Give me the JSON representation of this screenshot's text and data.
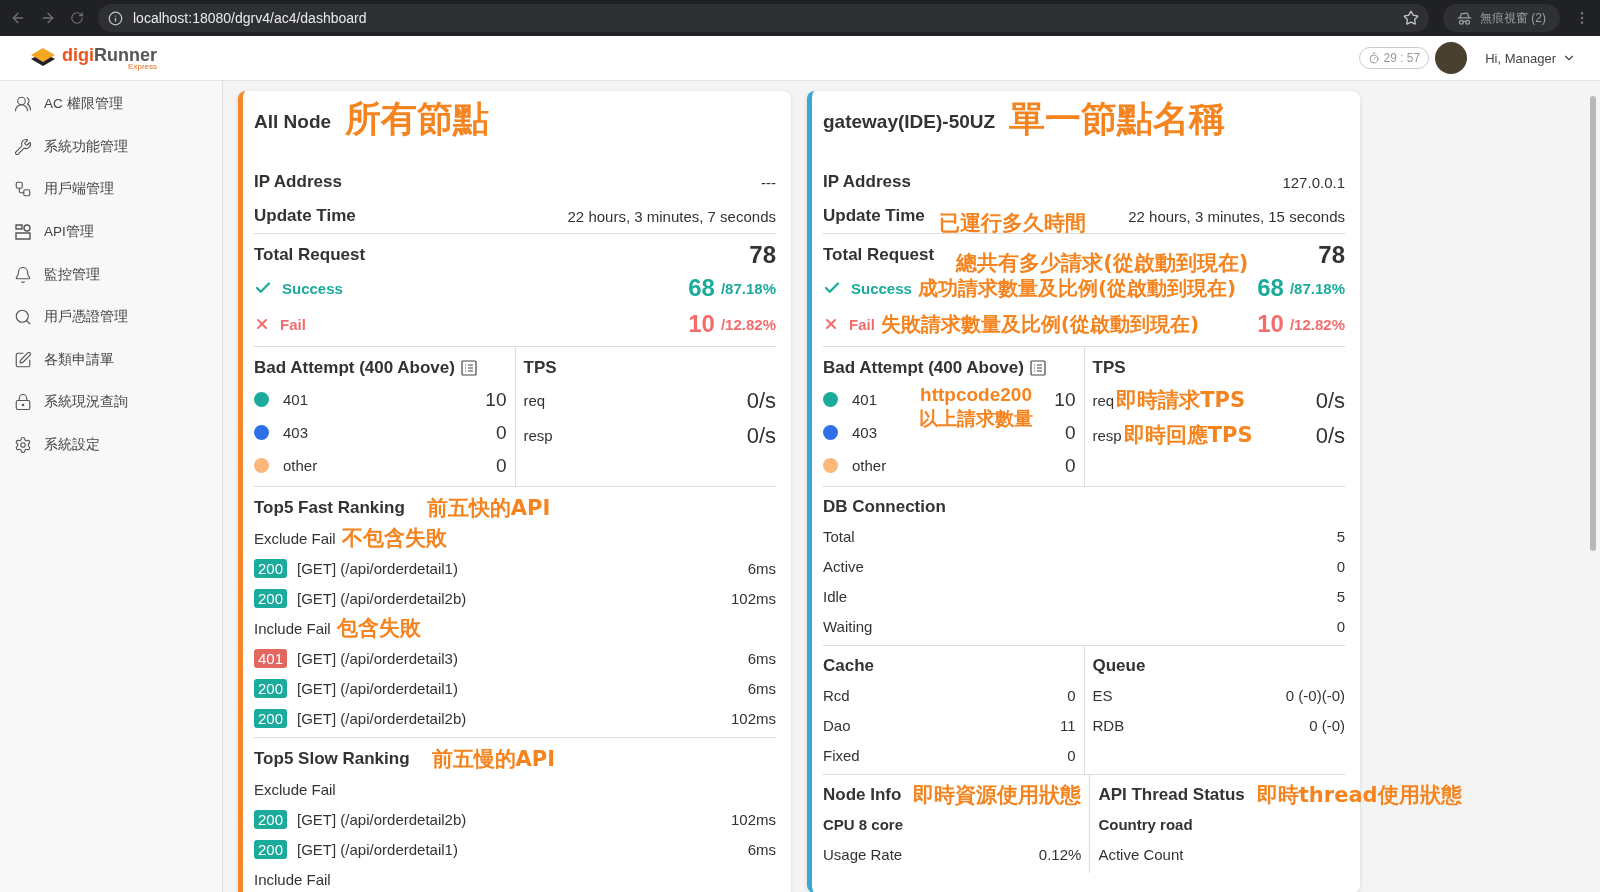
{
  "browser": {
    "url": "localhost:18080/dgrv4/ac4/dashboard",
    "profile": "無痕視窗 (2)"
  },
  "header": {
    "brand": "digiRunner",
    "brand_sub": "Express",
    "timer": "29 : 57",
    "greeting": "Hi, Manager"
  },
  "sidebar": {
    "items": [
      {
        "label": "AC 權限管理"
      },
      {
        "label": "系統功能管理"
      },
      {
        "label": "用戶端管理"
      },
      {
        "label": "API管理"
      },
      {
        "label": "監控管理"
      },
      {
        "label": "用戶憑證管理"
      },
      {
        "label": "各類申請單"
      },
      {
        "label": "系統現況查詢"
      },
      {
        "label": "系統設定"
      }
    ]
  },
  "cards": [
    {
      "color": "#f5882a",
      "title": "All Node",
      "note": "所有節點",
      "info": [
        {
          "label": "IP Address",
          "value": "---"
        },
        {
          "label": "Update Time",
          "value": "22 hours, 3 minutes, 7 seconds"
        }
      ],
      "total": {
        "label": "Total Request",
        "value": "78"
      },
      "outcomes": [
        {
          "kind": "success",
          "label": "Success",
          "count": "68",
          "ratio": "/87.18%"
        },
        {
          "kind": "fail",
          "label": "Fail",
          "count": "10",
          "ratio": "/12.82%"
        }
      ],
      "bad": {
        "title": "Bad Attempt (400 Above)",
        "rows": [
          {
            "label": "401",
            "value": "10",
            "color": "#1aab9b"
          },
          {
            "label": "403",
            "value": "0",
            "color": "#2f6fe8"
          },
          {
            "label": "other",
            "value": "0",
            "color": "#fbb87a"
          }
        ]
      },
      "tps": {
        "title": "TPS",
        "rows": [
          {
            "label": "req",
            "value": "0/s"
          },
          {
            "label": "resp",
            "value": "0/s"
          }
        ]
      },
      "sections": [
        {
          "kind": "ranking",
          "title": "Top5 Fast Ranking",
          "note": "前五快的API",
          "groups": [
            {
              "label": "Exclude Fail",
              "note": "不包含失敗",
              "rows": [
                {
                  "code": "200",
                  "color": "#1aab9b",
                  "path": "[GET] (/api/orderdetail1)",
                  "time": "6ms"
                },
                {
                  "code": "200",
                  "color": "#1aab9b",
                  "path": "[GET] (/api/orderdetail2b)",
                  "time": "102ms"
                }
              ]
            },
            {
              "label": "Include Fail",
              "note": "包含失敗",
              "rows": [
                {
                  "code": "401",
                  "color": "#e4675f",
                  "path": "[GET] (/api/orderdetail3)",
                  "time": "6ms"
                },
                {
                  "code": "200",
                  "color": "#1aab9b",
                  "path": "[GET] (/api/orderdetail1)",
                  "time": "6ms"
                },
                {
                  "code": "200",
                  "color": "#1aab9b",
                  "path": "[GET] (/api/orderdetail2b)",
                  "time": "102ms"
                }
              ]
            }
          ]
        },
        {
          "kind": "ranking",
          "title": "Top5 Slow Ranking",
          "note": "前五慢的API",
          "groups": [
            {
              "label": "Exclude Fail",
              "rows": [
                {
                  "code": "200",
                  "color": "#1aab9b",
                  "path": "[GET] (/api/orderdetail2b)",
                  "time": "102ms"
                },
                {
                  "code": "200",
                  "color": "#1aab9b",
                  "path": "[GET] (/api/orderdetail1)",
                  "time": "6ms"
                }
              ]
            },
            {
              "label": "Include Fail"
            }
          ]
        }
      ]
    },
    {
      "color": "#3aa6d4",
      "title": "gateway(IDE)-50UZ",
      "note": "單一節點名稱",
      "info": [
        {
          "label": "IP Address",
          "value": "127.0.0.1"
        },
        {
          "label": "Update Time",
          "value": "22 hours, 3 minutes, 15 seconds",
          "note": "已運行多久時間"
        }
      ],
      "total": {
        "label": "Total Request",
        "value": "78",
        "note": "總共有多少請求(從啟動到現在)"
      },
      "outcomes": [
        {
          "kind": "success",
          "label": "Success",
          "count": "68",
          "ratio": "/87.18%",
          "note": "成功請求數量及比例(從啟動到現在)"
        },
        {
          "kind": "fail",
          "label": "Fail",
          "count": "10",
          "ratio": "/12.82%",
          "note": "失敗請求數量及比例(從啟動到現在)"
        }
      ],
      "bad": {
        "title": "Bad Attempt (400 Above)",
        "note": [
          "httpcode200",
          "以上請求數量"
        ],
        "rows": [
          {
            "label": "401",
            "value": "10",
            "color": "#1aab9b"
          },
          {
            "label": "403",
            "value": "0",
            "color": "#2f6fe8"
          },
          {
            "label": "other",
            "value": "0",
            "color": "#fbb87a"
          }
        ]
      },
      "tps": {
        "title": "TPS",
        "rows": [
          {
            "label": "req",
            "value": "0/s",
            "note": "即時請求TPS"
          },
          {
            "label": "resp",
            "value": "0/s",
            "note": "即時回應TPS"
          }
        ]
      },
      "sections": [
        {
          "kind": "list",
          "title": "DB Connection",
          "rows": [
            {
              "label": "Total",
              "value": "5"
            },
            {
              "label": "Active",
              "value": "0"
            },
            {
              "label": "Idle",
              "value": "5"
            },
            {
              "label": "Waiting",
              "value": "0"
            }
          ]
        },
        {
          "kind": "split",
          "columns": [
            {
              "title": "Cache",
              "rows": [
                {
                  "label": "Rcd",
                  "value": "0"
                },
                {
                  "label": "Dao",
                  "value": "11"
                },
                {
                  "label": "Fixed",
                  "value": "0"
                }
              ]
            },
            {
              "title": "Queue",
              "rows": [
                {
                  "label": "ES",
                  "value": "0 (-0)(-0)"
                },
                {
                  "label": "RDB",
                  "value": "0 (-0)"
                }
              ]
            }
          ]
        },
        {
          "kind": "split",
          "columns": [
            {
              "title": "Node Info",
              "note": "即時資源使用狀態",
              "subtitle": "CPU 8 core",
              "rows": [
                {
                  "label": "Usage Rate",
                  "value": "0.12%"
                }
              ]
            },
            {
              "title": "API Thread Status",
              "note": "即時thread使用狀態",
              "subtitle": "Country road",
              "rows": [
                {
                  "label": "Active Count"
                }
              ]
            }
          ]
        }
      ]
    }
  ]
}
